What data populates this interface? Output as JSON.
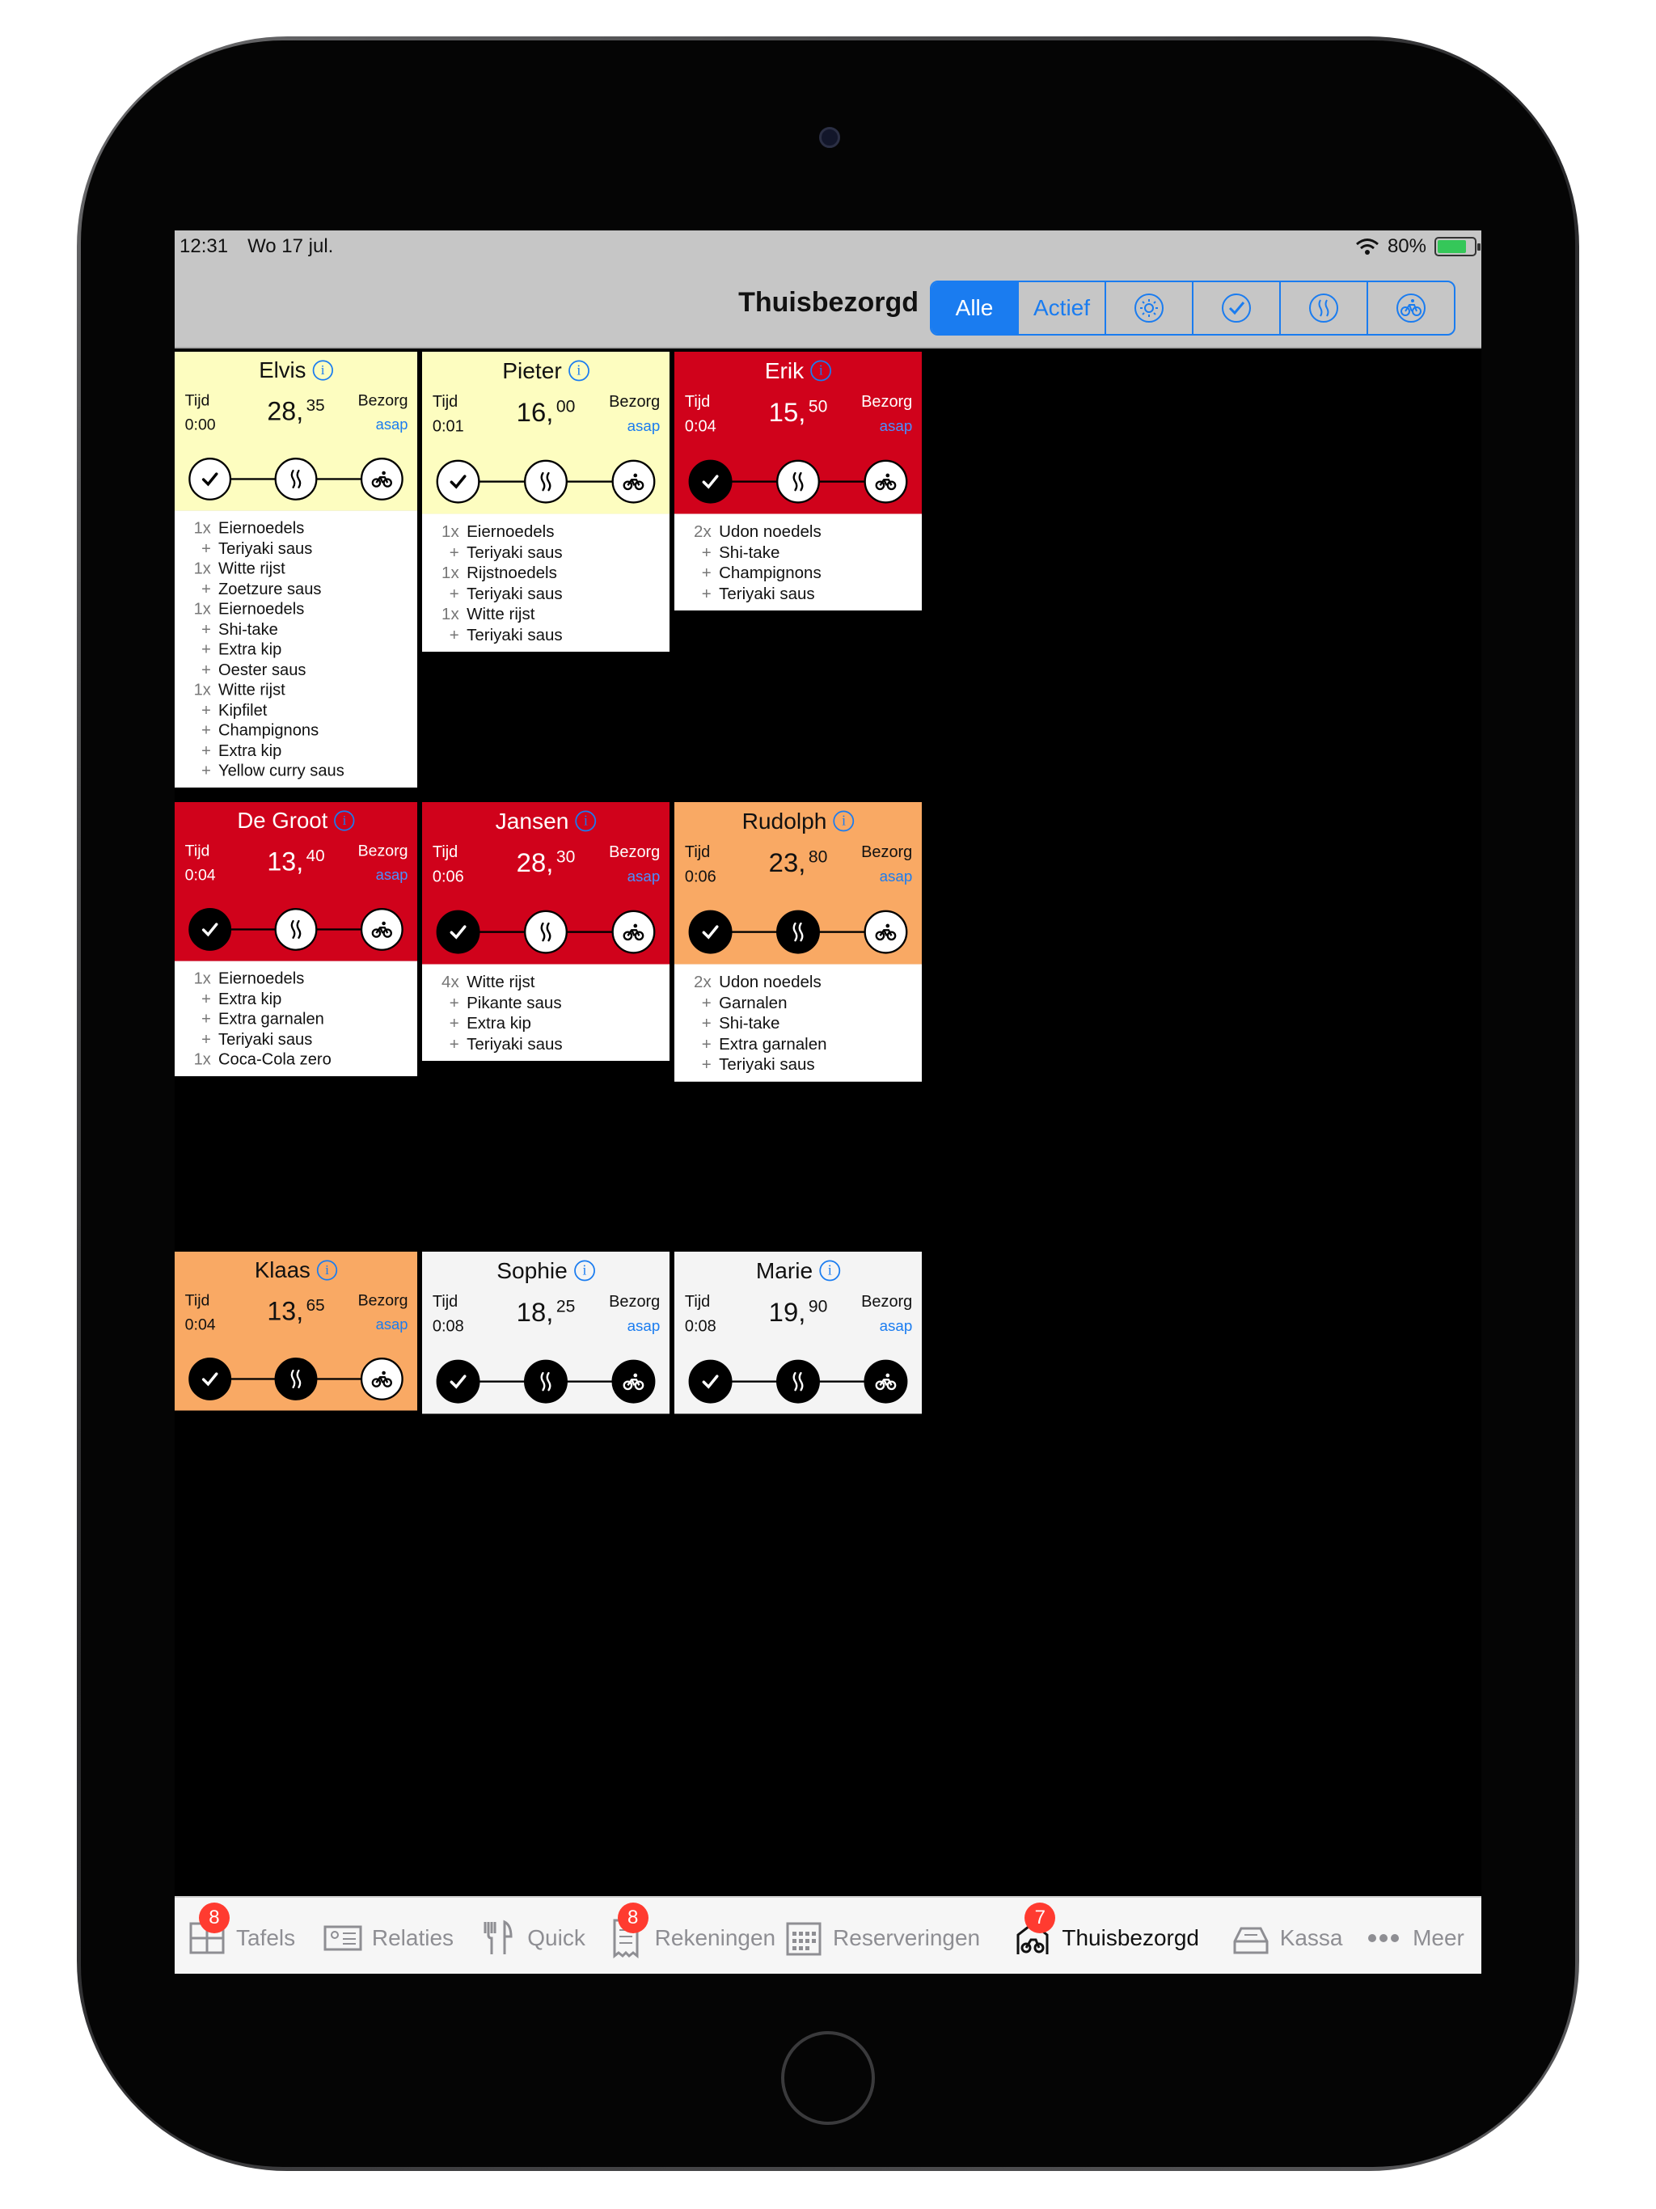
{
  "status_bar": {
    "time": "12:31",
    "date": "Wo 17 jul.",
    "battery": "80%"
  },
  "nav": {
    "title": "Thuisbezorgd",
    "segments": [
      {
        "label": "Alle",
        "icon": ""
      },
      {
        "label": "Actief",
        "icon": ""
      },
      {
        "label": "",
        "icon": "sun-icon"
      },
      {
        "label": "",
        "icon": "check-icon"
      },
      {
        "label": "",
        "icon": "steam-icon"
      },
      {
        "label": "",
        "icon": "bicycle-icon"
      }
    ],
    "selected_segment": "Alle"
  },
  "labels": {
    "tijd": "Tijd",
    "bezorg": "Bezorg",
    "info": "i"
  },
  "orders": [
    {
      "name": "Elvis",
      "tijd": "0:00",
      "price_main": "28,",
      "price_cents": "35",
      "bezorg": "asap",
      "color": "#fdfdc0",
      "steps_done": 0,
      "items": [
        {
          "qty": "1x",
          "name": "Eiernoedels"
        },
        {
          "qty": "+",
          "name": "Teriyaki saus"
        },
        {
          "qty": "1x",
          "name": "Witte rijst"
        },
        {
          "qty": "+",
          "name": "Zoetzure saus"
        },
        {
          "qty": "1x",
          "name": "Eiernoedels"
        },
        {
          "qty": "+",
          "name": "Shi-take"
        },
        {
          "qty": "+",
          "name": "Extra kip"
        },
        {
          "qty": "+",
          "name": "Oester saus"
        },
        {
          "qty": "1x",
          "name": "Witte rijst"
        },
        {
          "qty": "+",
          "name": "Kipfilet"
        },
        {
          "qty": "+",
          "name": "Champignons"
        },
        {
          "qty": "+",
          "name": "Extra kip"
        },
        {
          "qty": "+",
          "name": "Yellow curry saus"
        }
      ]
    },
    {
      "name": "Pieter",
      "tijd": "0:01",
      "price_main": "16,",
      "price_cents": "00",
      "bezorg": "asap",
      "color": "#fdfdc0",
      "steps_done": 0,
      "items": [
        {
          "qty": "1x",
          "name": "Eiernoedels"
        },
        {
          "qty": "+",
          "name": "Teriyaki saus"
        },
        {
          "qty": "1x",
          "name": "Rijstnoedels"
        },
        {
          "qty": "+",
          "name": "Teriyaki saus"
        },
        {
          "qty": "1x",
          "name": "Witte rijst"
        },
        {
          "qty": "+",
          "name": "Teriyaki saus"
        }
      ]
    },
    {
      "name": "Erik",
      "tijd": "0:04",
      "price_main": "15,",
      "price_cents": "50",
      "bezorg": "asap",
      "color": "#d0021b",
      "steps_done": 1,
      "items": [
        {
          "qty": "2x",
          "name": "Udon noedels"
        },
        {
          "qty": "+",
          "name": "Shi-take"
        },
        {
          "qty": "+",
          "name": "Champignons"
        },
        {
          "qty": "+",
          "name": "Teriyaki saus"
        }
      ]
    },
    {
      "name": "De Groot",
      "tijd": "0:04",
      "price_main": "13,",
      "price_cents": "40",
      "bezorg": "asap",
      "color": "#d0021b",
      "steps_done": 1,
      "items": [
        {
          "qty": "1x",
          "name": "Eiernoedels"
        },
        {
          "qty": "+",
          "name": "Extra kip"
        },
        {
          "qty": "+",
          "name": "Extra garnalen"
        },
        {
          "qty": "+",
          "name": "Teriyaki saus"
        },
        {
          "qty": "1x",
          "name": "Coca-Cola zero"
        }
      ]
    },
    {
      "name": "Jansen",
      "tijd": "0:06",
      "price_main": "28,",
      "price_cents": "30",
      "bezorg": "asap",
      "color": "#d0021b",
      "steps_done": 1,
      "items": [
        {
          "qty": "4x",
          "name": "Witte rijst"
        },
        {
          "qty": "+",
          "name": "Pikante saus"
        },
        {
          "qty": "+",
          "name": "Extra kip"
        },
        {
          "qty": "+",
          "name": "Teriyaki saus"
        }
      ]
    },
    {
      "name": "Rudolph",
      "tijd": "0:06",
      "price_main": "23,",
      "price_cents": "80",
      "bezorg": "asap",
      "color": "#f9a964",
      "steps_done": 2,
      "items": [
        {
          "qty": "2x",
          "name": "Udon noedels"
        },
        {
          "qty": "+",
          "name": "Garnalen"
        },
        {
          "qty": "+",
          "name": "Shi-take"
        },
        {
          "qty": "+",
          "name": "Extra garnalen"
        },
        {
          "qty": "+",
          "name": "Teriyaki saus"
        }
      ]
    },
    {
      "name": "Klaas",
      "tijd": "0:04",
      "price_main": "13,",
      "price_cents": "65",
      "bezorg": "asap",
      "color": "#f9a964",
      "steps_done": 2,
      "items": []
    },
    {
      "name": "Sophie",
      "tijd": "0:08",
      "price_main": "18,",
      "price_cents": "25",
      "bezorg": "asap",
      "color": "#f4f4f4",
      "steps_done": 3,
      "items": []
    },
    {
      "name": "Marie",
      "tijd": "0:08",
      "price_main": "19,",
      "price_cents": "90",
      "bezorg": "asap",
      "color": "#f4f4f4",
      "steps_done": 3,
      "items": []
    }
  ],
  "tabbar": [
    {
      "label": "Tafels",
      "icon": "tables-icon",
      "badge": "8"
    },
    {
      "label": "Relaties",
      "icon": "contacts-icon",
      "badge": ""
    },
    {
      "label": "Quick",
      "icon": "cutlery-icon",
      "badge": ""
    },
    {
      "label": "Rekeningen",
      "icon": "receipt-icon",
      "badge": "8"
    },
    {
      "label": "Reserveringen",
      "icon": "calendar-icon",
      "badge": ""
    },
    {
      "label": "Thuisbezorgd",
      "icon": "delivery-icon",
      "badge": "7",
      "active": true
    },
    {
      "label": "Kassa",
      "icon": "register-icon",
      "badge": ""
    },
    {
      "label": "Meer",
      "icon": "more-icon",
      "badge": ""
    }
  ]
}
